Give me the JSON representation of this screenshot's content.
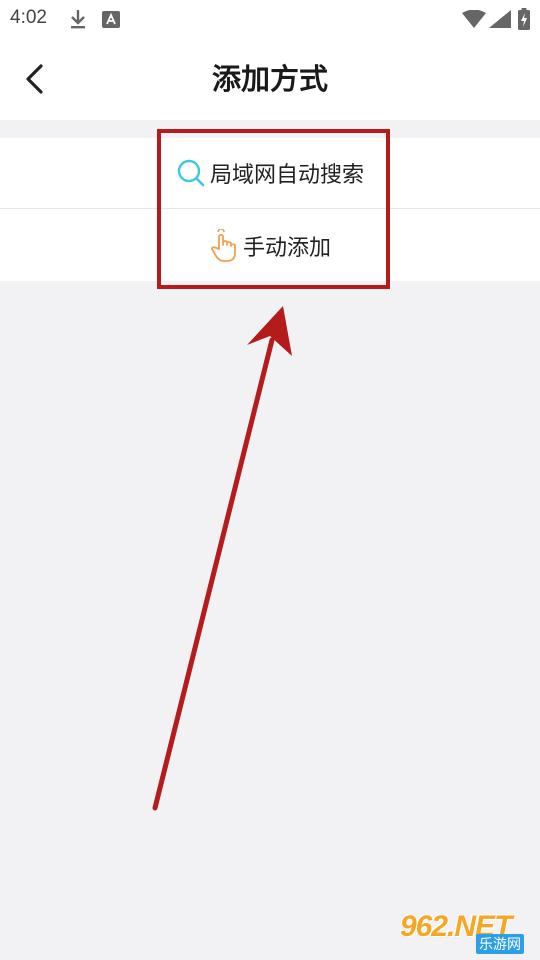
{
  "status_bar": {
    "time": "4:02"
  },
  "header": {
    "title": "添加方式"
  },
  "options": [
    {
      "label": "局域网自动搜索",
      "icon": "search-icon"
    },
    {
      "label": "手动添加",
      "icon": "hand-pointer-icon"
    }
  ],
  "watermark": {
    "logo": "962.NET",
    "sub": "乐游网"
  },
  "colors": {
    "highlight": "#b41b1b",
    "search_icon": "#3ec6e0",
    "hand_icon": "#f0a050",
    "background": "#f2f2f4"
  }
}
